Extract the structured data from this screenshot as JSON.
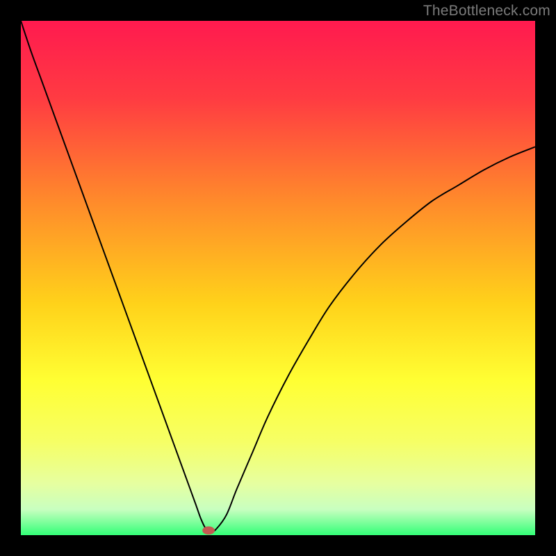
{
  "watermark": "TheBottleneck.com",
  "chart_data": {
    "type": "line",
    "title": "",
    "xlabel": "",
    "ylabel": "",
    "xlim": [
      0,
      100
    ],
    "ylim": [
      0,
      100
    ],
    "grid": false,
    "background_gradient": {
      "direction": "vertical",
      "stops": [
        {
          "offset": 0.0,
          "color": "#ff1a4f"
        },
        {
          "offset": 0.15,
          "color": "#ff3b42"
        },
        {
          "offset": 0.35,
          "color": "#ff8a2b"
        },
        {
          "offset": 0.55,
          "color": "#ffd21a"
        },
        {
          "offset": 0.7,
          "color": "#ffff33"
        },
        {
          "offset": 0.82,
          "color": "#f6ff66"
        },
        {
          "offset": 0.9,
          "color": "#e6ffa0"
        },
        {
          "offset": 0.95,
          "color": "#c8ffc0"
        },
        {
          "offset": 1.0,
          "color": "#33ff77"
        }
      ]
    },
    "series": [
      {
        "name": "curve",
        "color": "#000000",
        "width": 2,
        "x": [
          0,
          2,
          4,
          6,
          8,
          10,
          12,
          14,
          16,
          18,
          20,
          22,
          24,
          26,
          28,
          30,
          32,
          34,
          35,
          36,
          37,
          38,
          40,
          42,
          45,
          48,
          52,
          56,
          60,
          65,
          70,
          75,
          80,
          85,
          90,
          95,
          100
        ],
        "y": [
          100,
          94,
          88.5,
          83,
          77.5,
          72,
          66.5,
          61,
          55.5,
          50,
          44.5,
          39,
          33.5,
          28,
          22.5,
          17,
          11.5,
          6,
          3.2,
          1.2,
          0.7,
          1.2,
          4,
          9,
          16,
          23,
          31,
          38,
          44.5,
          51,
          56.5,
          61,
          65,
          68,
          71,
          73.5,
          75.5
        ]
      }
    ],
    "marker": {
      "x": 36.5,
      "y": 0.9,
      "rx": 1.2,
      "ry": 0.8,
      "color": "#c45a52"
    }
  }
}
